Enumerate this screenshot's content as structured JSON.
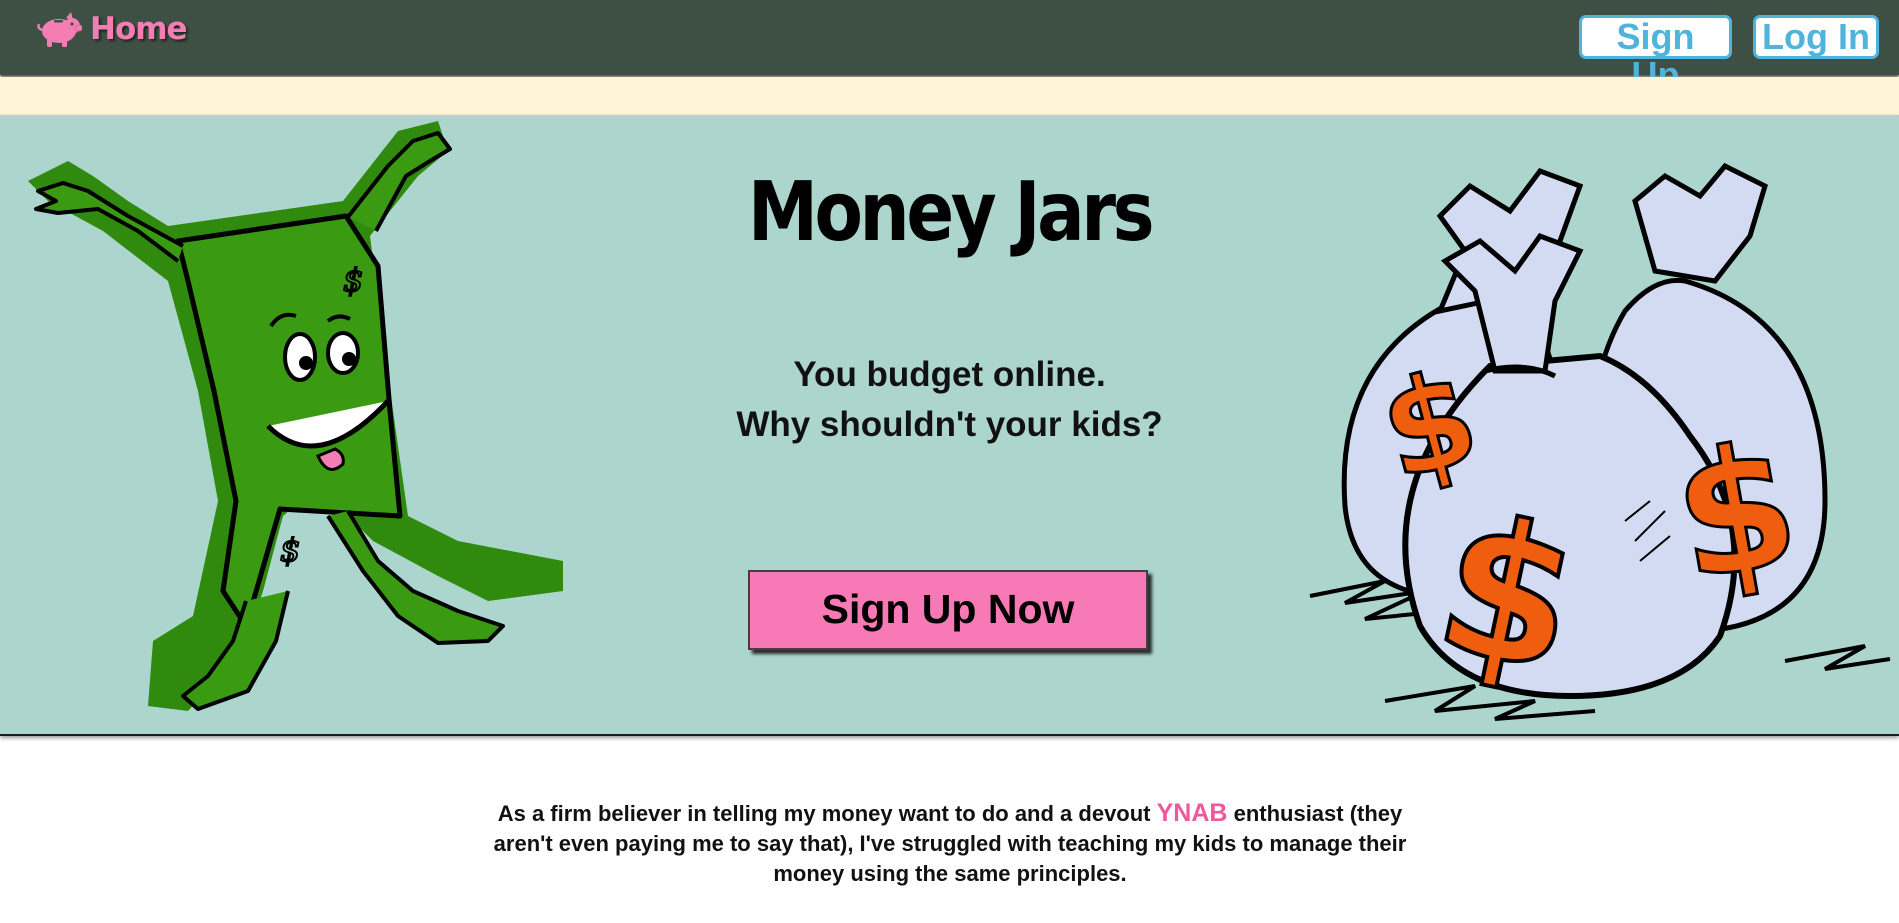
{
  "nav": {
    "home_label": "Home",
    "signup_label": "Sign Up",
    "login_label": "Log In"
  },
  "hero": {
    "title": "Money Jars",
    "tagline_line1": "You budget online.",
    "tagline_line2": "Why shouldn't your kids?",
    "cta_label": "Sign Up Now"
  },
  "intro": {
    "text_before": "As a firm believer in telling my money want to do and a devout ",
    "link_text": "YNAB",
    "text_after": " enthusiast (they aren't even paying me to say that), I've struggled with teaching my kids to manage their money using the same principles."
  },
  "icons": {
    "brand": "piggy-bank-icon",
    "mascot": "dollar-bill-mascot",
    "bags": "money-bags-illustration"
  },
  "colors": {
    "navbar": "#3e4f44",
    "brand_pink": "#f47eb4",
    "button_blue": "#4fb3dc",
    "cream": "#fff4d6",
    "hero_bg": "#acd6cd",
    "cta_pink": "#f77ab6",
    "link_pink": "#f0589c",
    "mascot_green": "#2f8a0e",
    "bag_fill": "#d2dbf1",
    "dollar_orange": "#ef5e0e"
  }
}
